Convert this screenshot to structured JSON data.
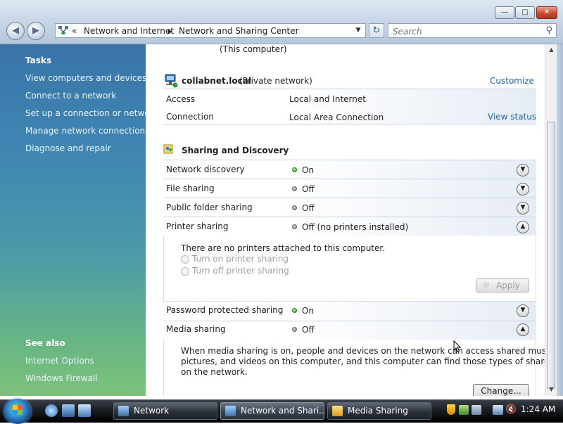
{
  "titlebar": {
    "buttons": {
      "minimize": "—",
      "maximize": "□",
      "close": "✕"
    },
    "nav": {
      "back": "◀",
      "forward": "▶"
    },
    "address": {
      "chevrons": "«",
      "crumb1": "Network and Internet",
      "sep": "▶",
      "crumb2": "Network and Sharing Center",
      "dropdown": "▼"
    },
    "refresh": "↻",
    "search": {
      "placeholder": "Search",
      "icon": "search-icon"
    }
  },
  "sidebar": {
    "tasks_header": "Tasks",
    "tasks": [
      "View computers and devices",
      "Connect to a network",
      "Set up a connection or network",
      "Manage network connections",
      "Diagnose and repair"
    ],
    "see_also_header": "See also",
    "see_also": [
      "Internet Options",
      "Windows Firewall"
    ]
  },
  "network": {
    "this_computer": "(This computer)",
    "name": "collabnet.local",
    "type": "(Private network)",
    "customize": "Customize",
    "access_label": "Access",
    "access_value": "Local and Internet",
    "connection_label": "Connection",
    "connection_value": "Local Area Connection",
    "view_status": "View status"
  },
  "sharing": {
    "header": "Sharing and Discovery",
    "rows": [
      {
        "label": "Network discovery",
        "status": "On",
        "state": "on"
      },
      {
        "label": "File sharing",
        "status": "Off",
        "state": "off"
      },
      {
        "label": "Public folder sharing",
        "status": "Off",
        "state": "off"
      },
      {
        "label": "Printer sharing",
        "status": "Off (no printers installed)",
        "state": "off"
      },
      {
        "label": "Password protected sharing",
        "status": "On",
        "state": "on"
      },
      {
        "label": "Media sharing",
        "status": "Off",
        "state": "off"
      }
    ],
    "printer_panel": {
      "message": "There are no printers attached to this computer.",
      "option_on": "Turn on printer sharing",
      "option_off": "Turn off printer sharing",
      "apply": "Apply"
    },
    "media_panel": {
      "line1": "When media sharing is on, people and devices on the network can access shared music,",
      "line2": "pictures, and videos on this computer, and this computer can find those types of shared files",
      "line3": "on the network.",
      "change": "Change..."
    },
    "chevron_down": "▼",
    "chevron_up": "▲"
  },
  "scrollbar": {
    "up": "▲",
    "down": "▼"
  },
  "taskbar": {
    "windows": [
      {
        "label": "Network",
        "active": false
      },
      {
        "label": "Network and Shari...",
        "active": true
      },
      {
        "label": "Media Sharing",
        "active": false
      }
    ],
    "clock": "1:24 AM"
  },
  "colors": {
    "link": "#1a63b3",
    "on": "#2da51b",
    "off": "#7b7b7b",
    "sidebar_top": "#3a74a8",
    "sidebar_bottom": "#7cc27a"
  }
}
